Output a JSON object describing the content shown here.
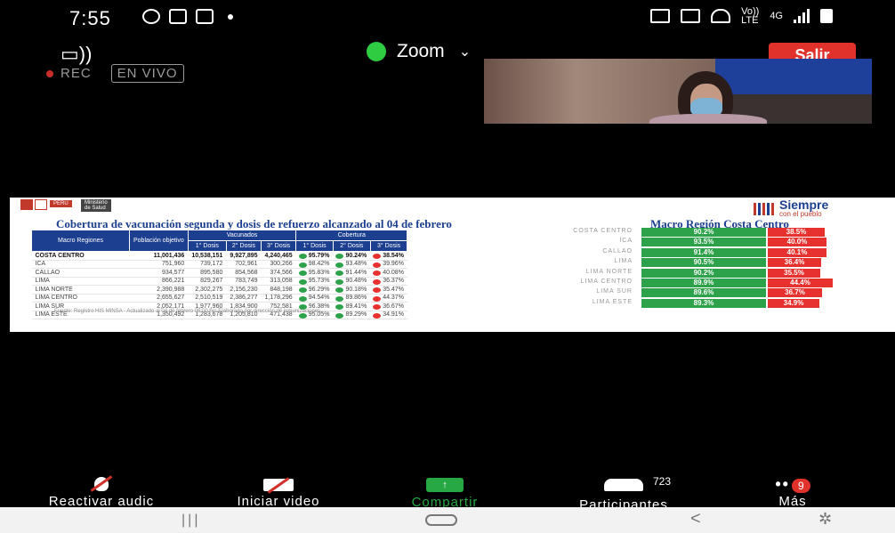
{
  "status_bar": {
    "time": "7:55",
    "volte": "Vo))\nLTE",
    "network": "4G"
  },
  "meeting": {
    "app_name": "Zoom",
    "leave_label": "Salir",
    "rec_label": "REC",
    "live_label": "EN VIVO"
  },
  "slide": {
    "header_left": "PERÚ",
    "ministry": "Ministerio\nde Salud",
    "logo_text": "Siempre",
    "logo_sub": "con el pueblo",
    "title": "Cobertura de vacunación segunda y dosis de refuerzo alcanzado al 04 de febrero",
    "title_right": "Macro Región Costa Centro",
    "table": {
      "head_groups": [
        "Macro Regiones",
        "Población objetivo",
        "Vacunados",
        "Cobertura"
      ],
      "subheads": [
        "1° Dosis",
        "2° Dosis",
        "3° Dosis",
        "1° Dosis",
        "2° Dosis",
        "3° Dosis"
      ],
      "rows": [
        {
          "region": "COSTA CENTRO",
          "pob": "11,001,436",
          "d1": "10,538,151",
          "d2": "9,927,895",
          "d3": "4,240,465",
          "c1": "95.79%",
          "c2": "90.24%",
          "c3": "38.54%"
        },
        {
          "region": "ICA",
          "pob": "751,960",
          "d1": "739,172",
          "d2": "702,961",
          "d3": "300,266",
          "c1": "98.42%",
          "c2": "93.48%",
          "c3": "39.96%"
        },
        {
          "region": "CALLAO",
          "pob": "934,577",
          "d1": "895,580",
          "d2": "854,568",
          "d3": "374,566",
          "c1": "95.83%",
          "c2": "91.44%",
          "c3": "40.08%"
        },
        {
          "region": "LIMA",
          "pob": "866,221",
          "d1": "829,267",
          "d2": "783,749",
          "d3": "313,058",
          "c1": "95.73%",
          "c2": "90.48%",
          "c3": "36.37%"
        },
        {
          "region": "LIMA NORTE",
          "pob": "2,390,988",
          "d1": "2,302,275",
          "d2": "2,156,230",
          "d3": "848,198",
          "c1": "96.29%",
          "c2": "90.18%",
          "c3": "35.47%"
        },
        {
          "region": "LIMA CENTRO",
          "pob": "2,655,627",
          "d1": "2,510,519",
          "d2": "2,386,277",
          "d3": "1,178,296",
          "c1": "94.54%",
          "c2": "89.86%",
          "c3": "44.37%"
        },
        {
          "region": "LIMA SUR",
          "pob": "2,052,171",
          "d1": "1,977,960",
          "d2": "1,834,900",
          "d3": "752,581",
          "c1": "96.38%",
          "c2": "89.41%",
          "c3": "36.67%"
        },
        {
          "region": "LIMA ESTE",
          "pob": "1,350,492",
          "d1": "1,283,678",
          "d2": "1,205,810",
          "d3": "471,438",
          "c1": "95.05%",
          "c2": "89.29%",
          "c3": "34.91%"
        }
      ]
    },
    "footnote": "Fuente: Registro HIS MINSA - Actualizado al 04 de febrero   06:00 hrs   Elaborado por dirección de inmunizaciones",
    "chart": {
      "rows": [
        {
          "region": "COSTA CENTRO",
          "second": "90.2%",
          "third": "38.5%",
          "third_frac": 0.385
        },
        {
          "region": "ICA",
          "second": "93.5%",
          "third": "40.0%",
          "third_frac": 0.4
        },
        {
          "region": "CALLAO",
          "second": "91.4%",
          "third": "40.1%",
          "third_frac": 0.401
        },
        {
          "region": "LIMA",
          "second": "90.5%",
          "third": "36.4%",
          "third_frac": 0.364
        },
        {
          "region": "LIMA NORTE",
          "second": "90.2%",
          "third": "35.5%",
          "third_frac": 0.355
        },
        {
          "region": "LIMA CENTRO",
          "second": "89.9%",
          "third": "44.4%",
          "third_frac": 0.444
        },
        {
          "region": "LIMA SUR",
          "second": "89.6%",
          "third": "36.7%",
          "third_frac": 0.367
        },
        {
          "region": "LIMA ESTE",
          "second": "89.3%",
          "third": "34.9%",
          "third_frac": 0.349
        }
      ]
    }
  },
  "controls": {
    "mic_label": "Reactivar audic",
    "video_label": "Iniciar video",
    "share_label": "Compartir",
    "participants_label": "Participantes",
    "participants_count": "723",
    "more_label": "Más",
    "more_badge": "9"
  },
  "colors": {
    "accent_green": "#2ea24a",
    "accent_red": "#e6312e",
    "navy": "#1d3f8f"
  }
}
